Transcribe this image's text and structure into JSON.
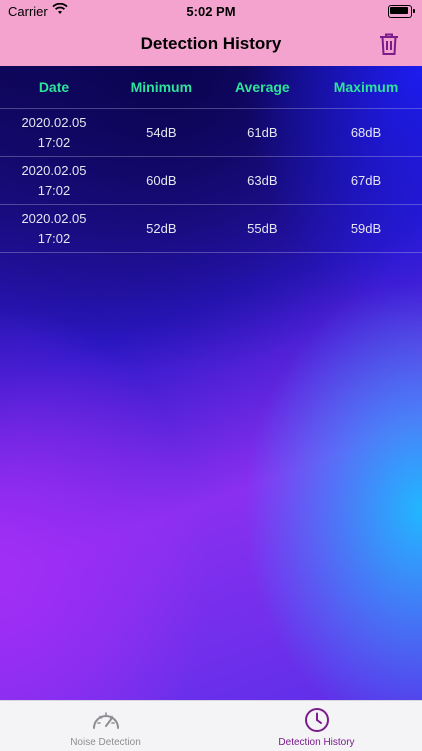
{
  "status_bar": {
    "carrier": "Carrier",
    "time": "5:02 PM"
  },
  "nav_bar": {
    "title": "Detection History",
    "trash_icon": "trash-icon"
  },
  "table": {
    "headers": [
      "Date",
      "Minimum",
      "Average",
      "Maximum"
    ],
    "rows": [
      {
        "date": "2020.02.05\n17:02",
        "minimum": "54dB",
        "average": "61dB",
        "maximum": "68dB"
      },
      {
        "date": "2020.02.05\n17:02",
        "minimum": "60dB",
        "average": "63dB",
        "maximum": "67dB"
      },
      {
        "date": "2020.02.05\n17:02",
        "minimum": "52dB",
        "average": "55dB",
        "maximum": "59dB"
      }
    ]
  },
  "tab_bar": {
    "tabs": [
      {
        "label": "Noise Detection",
        "icon": "gauge-icon",
        "active": false
      },
      {
        "label": "Detection History",
        "icon": "clock-icon",
        "active": true
      }
    ]
  },
  "colors": {
    "nav_background": "#f4a3cf",
    "header_text": "#2ee39a",
    "active_tab": "#7b1c8c",
    "inactive_tab": "#8e8e93"
  }
}
